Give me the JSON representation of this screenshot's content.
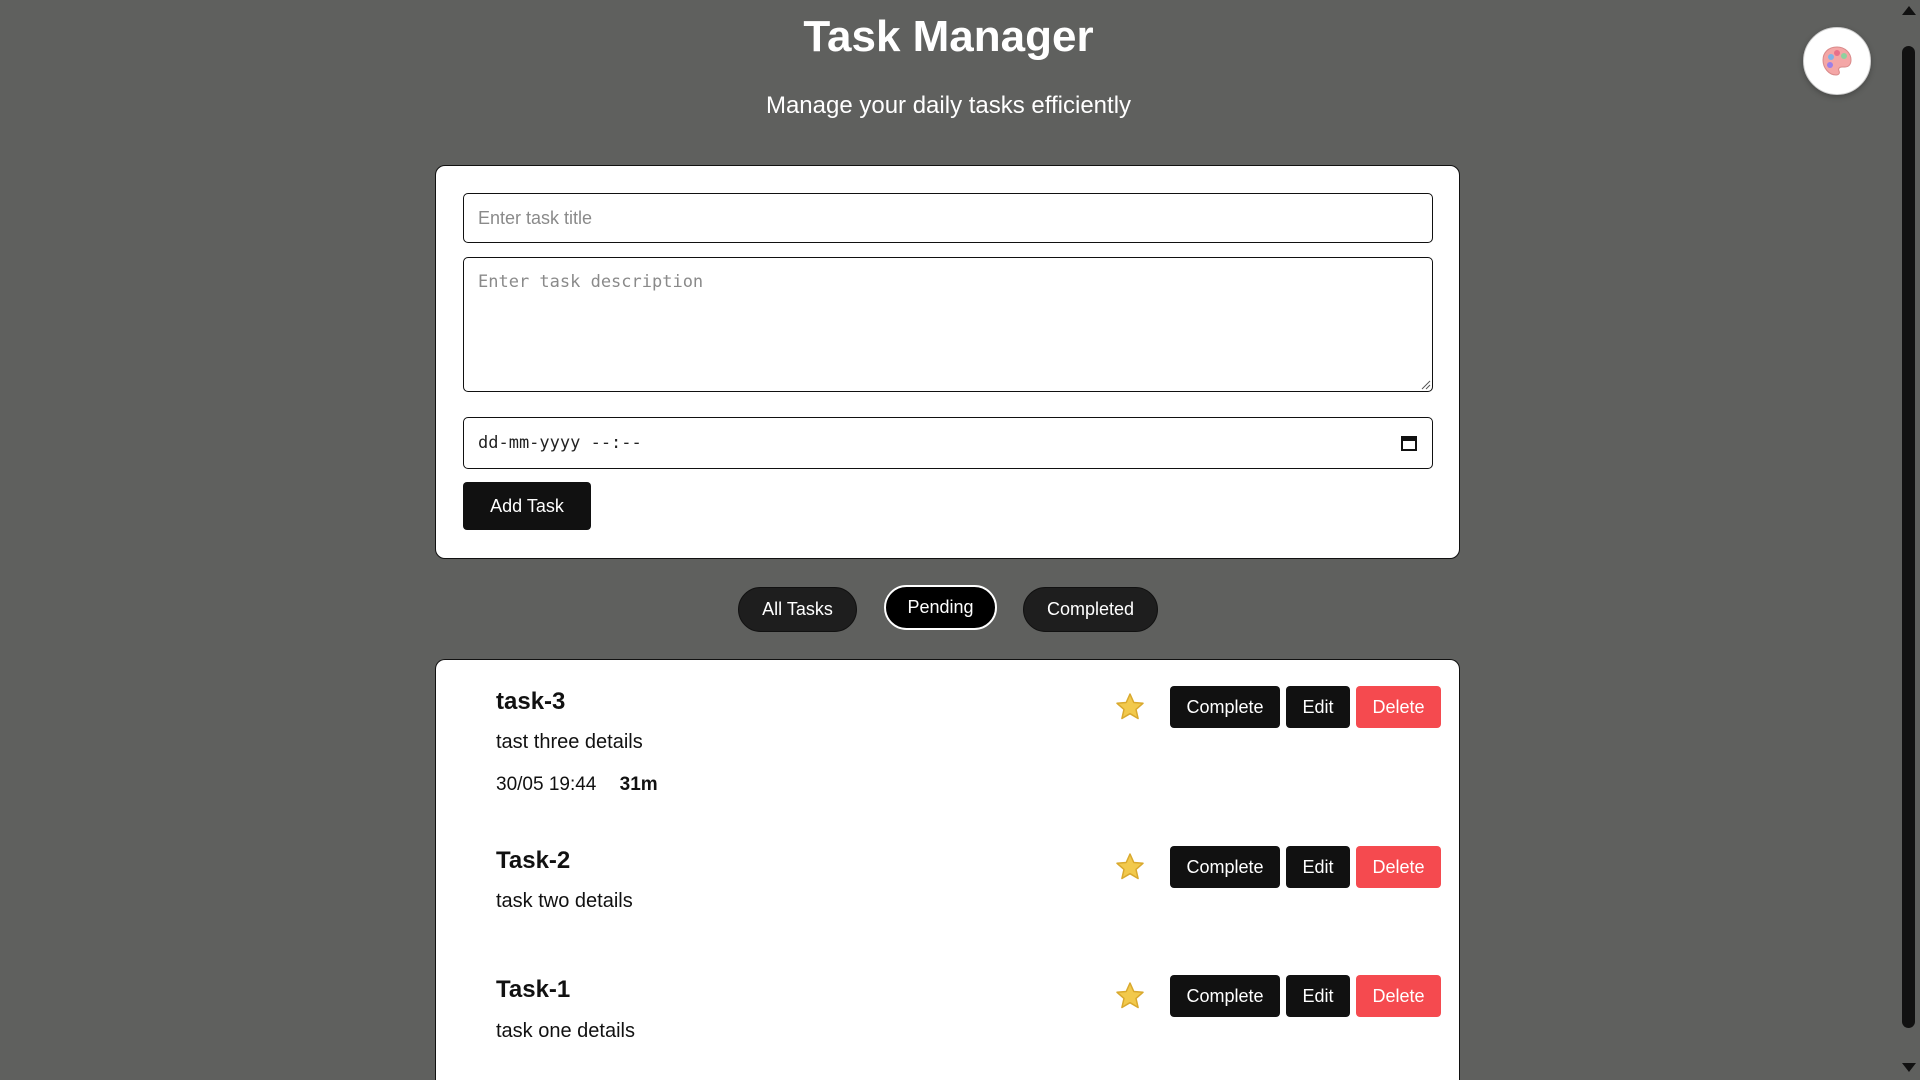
{
  "header": {
    "title": "Task Manager",
    "subtitle": "Manage your daily tasks efficiently"
  },
  "theme_toggle": {
    "icon": "palette-icon"
  },
  "form": {
    "title_placeholder": "Enter task title",
    "title_value": "",
    "description_placeholder": "Enter task description",
    "description_value": "",
    "datetime_placeholder": "dd-mm-yyyy --:--",
    "add_label": "Add Task"
  },
  "filters": {
    "all_label": "All Tasks",
    "pending_label": "Pending",
    "completed_label": "Completed",
    "active": "Pending"
  },
  "tasks": [
    {
      "title": "task-3",
      "description": "tast three details",
      "due": "30/05 19:44",
      "remaining": "31m",
      "starred": true
    },
    {
      "title": "Task-2",
      "description": "task two details",
      "starred": true
    },
    {
      "title": "Task-1",
      "description": "task one details",
      "starred": true
    }
  ],
  "task_actions": {
    "complete_label": "Complete",
    "edit_label": "Edit",
    "delete_label": "Delete"
  },
  "colors": {
    "background": "#5f605e",
    "primary_button": "#111111",
    "delete_button": "#f54a4f",
    "star": "#f2c94c"
  }
}
